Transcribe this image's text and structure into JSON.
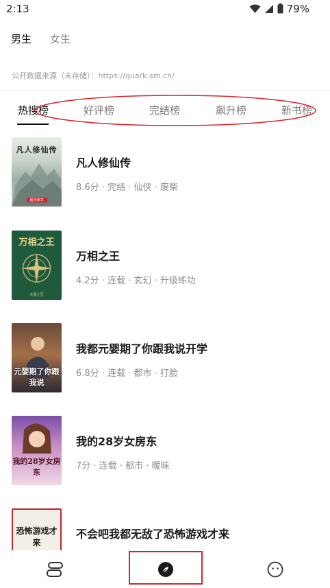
{
  "status": {
    "time": "2:13",
    "battery": "79%"
  },
  "gender_tabs": [
    {
      "label": "男生"
    },
    {
      "label": "女生"
    }
  ],
  "source_note": "公开数据来源（未存储）：https://quark.sm.cn/",
  "rank_tabs": [
    {
      "label": "热搜榜"
    },
    {
      "label": "好评榜"
    },
    {
      "label": "完结榜"
    },
    {
      "label": "飙升榜"
    },
    {
      "label": "新书榜"
    }
  ],
  "books": [
    {
      "title": "凡人修仙传",
      "meta": "8.6分 · 完结 · 仙侠 · 废柴",
      "cover_text": "凡人修仙传",
      "cover_publisher": "起点读书"
    },
    {
      "title": "万相之王",
      "meta": "4.2分 · 连载 · 玄幻 · 升级练功",
      "cover_text": "万相之王",
      "cover_author": "天蚕土豆"
    },
    {
      "title": "我都元婴期了你跟我说开学",
      "meta": "6.8分 · 连载 · 都市 · 打脸",
      "cover_text": "元婴期了你跟我说"
    },
    {
      "title": "我的28岁女房东",
      "meta": "7分 · 连载 · 都市 · 暧昧",
      "cover_text": "我的28岁女房东"
    },
    {
      "title": "不会吧我都无敌了恐怖游戏才来",
      "meta": "",
      "cover_text": "恐怖游戏才来"
    }
  ],
  "colors": {
    "highlight": "#d9242a",
    "accent_text": "#111111",
    "muted_text": "#8d8d8d"
  },
  "nav": [
    {
      "icon": "bookshelf-icon"
    },
    {
      "icon": "discover-icon"
    },
    {
      "icon": "profile-icon"
    }
  ]
}
